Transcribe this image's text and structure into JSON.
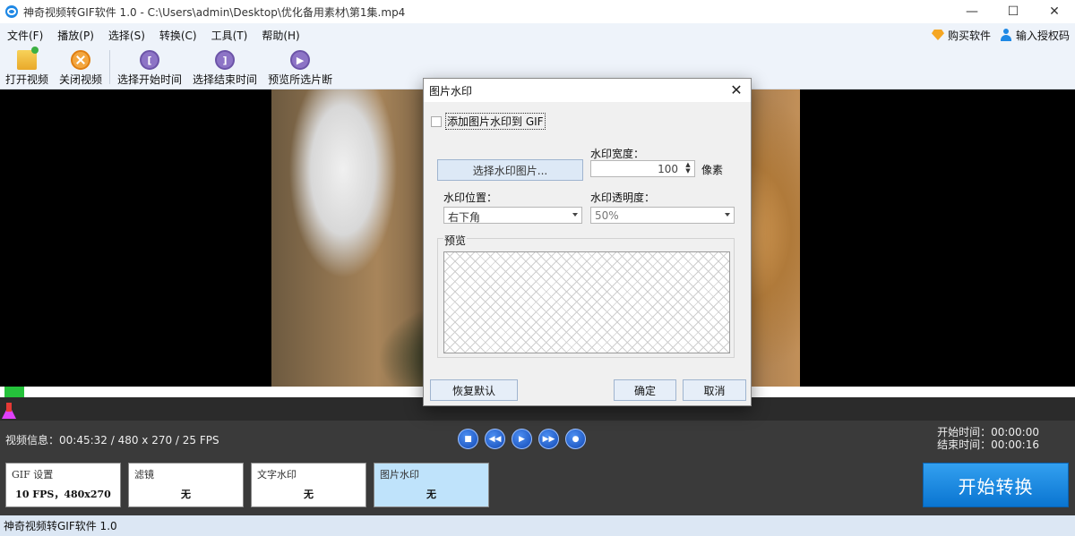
{
  "window": {
    "title": "神奇视频转GIF软件 1.0 - C:\\Users\\admin\\Desktop\\优化备用素材\\第1集.mp4",
    "minimize": "—",
    "maximize": "☐",
    "close": "✕"
  },
  "menu": {
    "items": [
      "文件(F)",
      "播放(P)",
      "选择(S)",
      "转换(C)",
      "工具(T)",
      "帮助(H)"
    ],
    "buy": "购买软件",
    "license": "输入授权码"
  },
  "toolbar": {
    "open_video": "打开视频",
    "close_video": "关闭视频",
    "select_start": "选择开始时间",
    "select_end": "选择结束时间",
    "preview_clip": "预览所选片断"
  },
  "info": {
    "video_info": "视频信息：00:45:32 / 480 x 270 / 25 FPS",
    "start_time": "开始时间：00:00:00",
    "end_time": "结束时间：00:00:16",
    "timeline_progress": 0.018
  },
  "cards": {
    "gif_settings": {
      "title": "GIF 设置",
      "value": "10 FPS，480x270"
    },
    "filter": {
      "title": "滤镜",
      "value": "无"
    },
    "text_watermark": {
      "title": "文字水印",
      "value": "无"
    },
    "image_watermark": {
      "title": "图片水印",
      "value": "无"
    }
  },
  "start_button": "开始转换",
  "status": "神奇视频转GIF软件 1.0",
  "dialog": {
    "title": "图片水印",
    "close": "✕",
    "add_checkbox_label": "添加图片水印到 GIF",
    "add_checked": false,
    "width_label": "水印宽度：",
    "pick_image_button": "选择水印图片...",
    "width_value": "100",
    "width_unit": "像素",
    "position_label": "水印位置：",
    "position_value": "右下角",
    "opacity_label": "水印透明度：",
    "opacity_value": "50%",
    "preview_label": "预览",
    "reset_button": "恢复默认",
    "ok_button": "确定",
    "cancel_button": "取消"
  },
  "colors": {
    "accent": "#1e88e5",
    "timeline_played": "#25c23b",
    "start_button": "#1a86e0",
    "active_card": "#bfe3fb"
  }
}
